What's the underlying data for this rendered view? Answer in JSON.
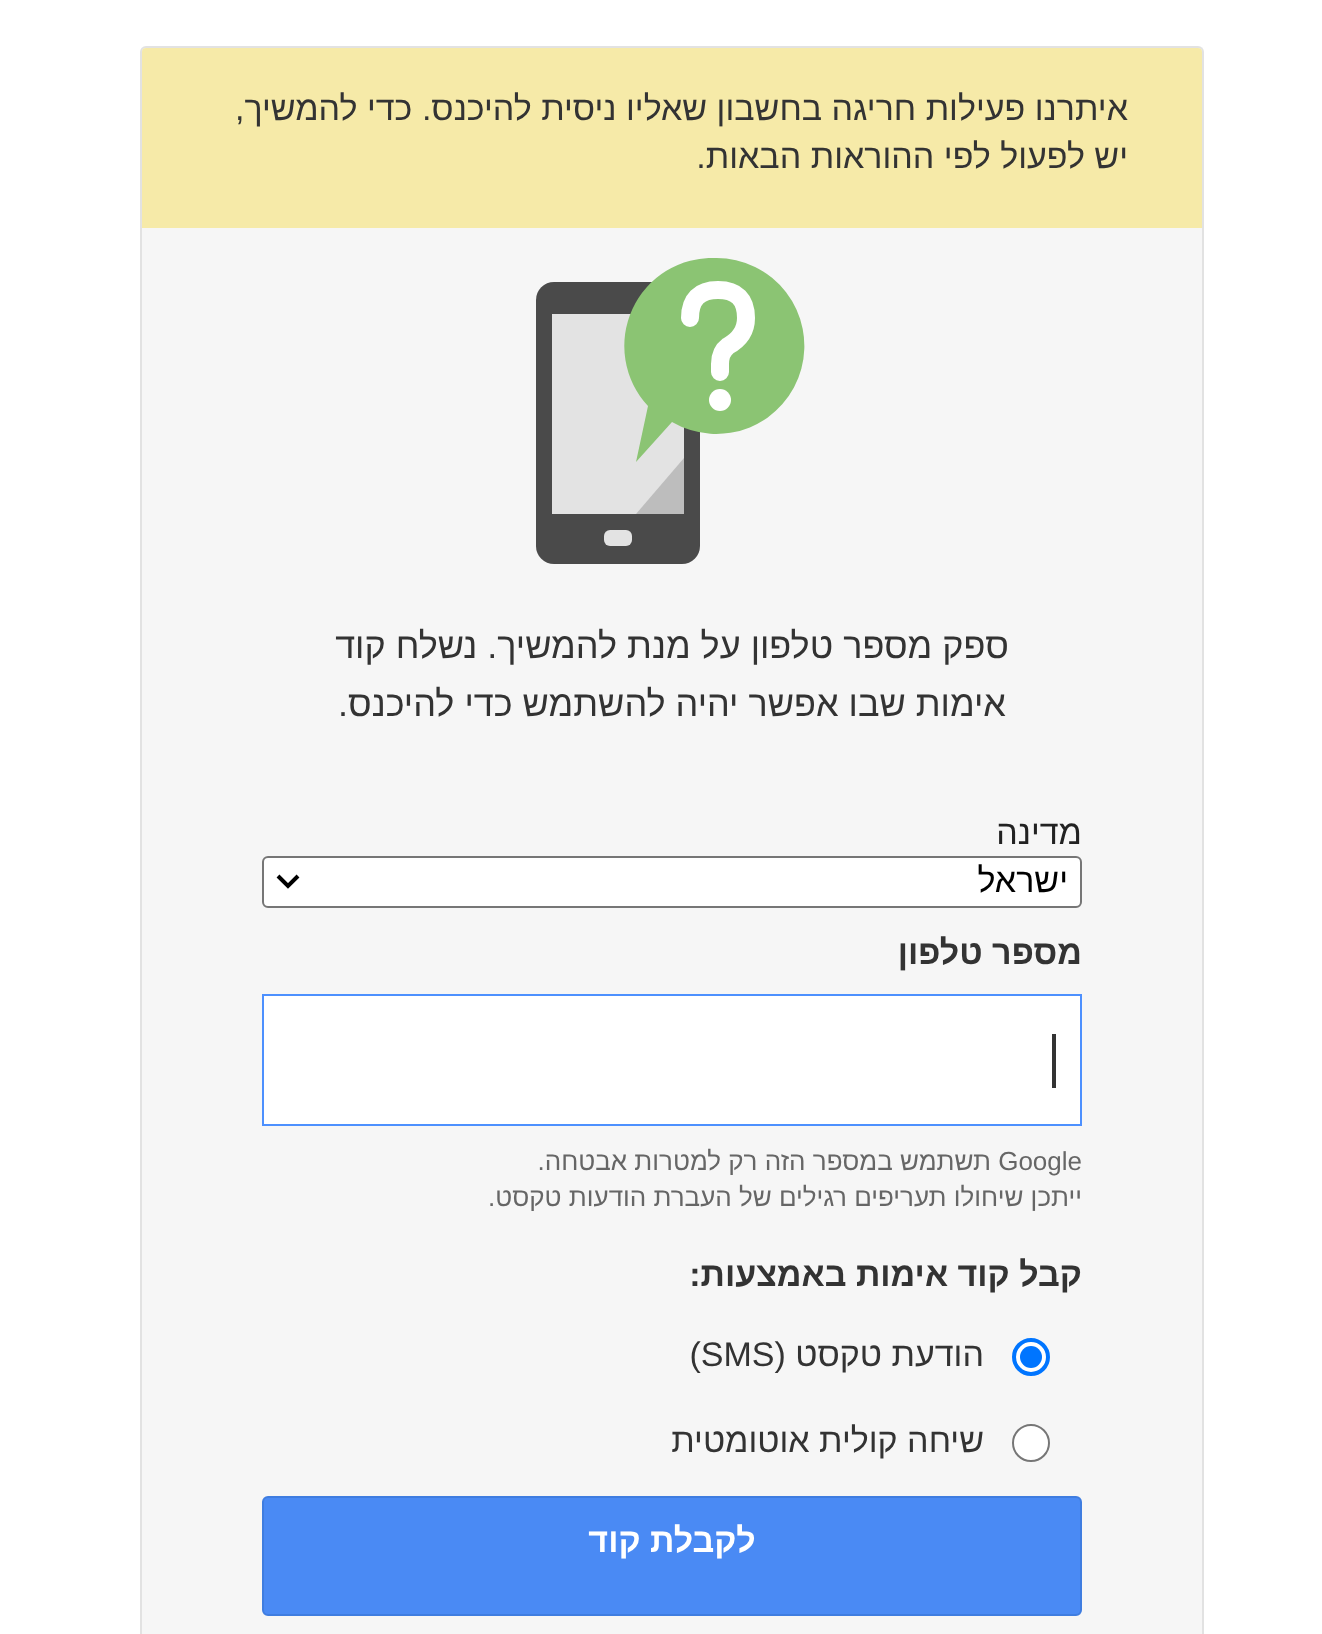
{
  "alert": {
    "text": "איתרנו פעילות חריגה בחשבון שאליו ניסית להיכנס. כדי להמשיך, יש לפעול לפי ההוראות הבאות."
  },
  "intro": "ספק מספר טלפון על מנת להמשיך. נשלח קוד אימות שבו אפשר יהיה להשתמש כדי להיכנס.",
  "country": {
    "label": "מדינה",
    "value": "ישראל"
  },
  "phone": {
    "label": "מספר טלפון",
    "focused": true
  },
  "hints": [
    "Google תשתמש במספר הזה רק למטרות אבטחה.",
    "ייתכן שיחולו תעריפים רגילים של העברת הודעות טקסט."
  ],
  "method": {
    "heading": "קבל קוד אימות באמצעות:",
    "options": [
      {
        "label": "הודעת טקסט (SMS)",
        "selected": true
      },
      {
        "label": "שיחה קולית אוטומטית",
        "selected": false
      }
    ]
  },
  "submit": "לקבלת קוד"
}
